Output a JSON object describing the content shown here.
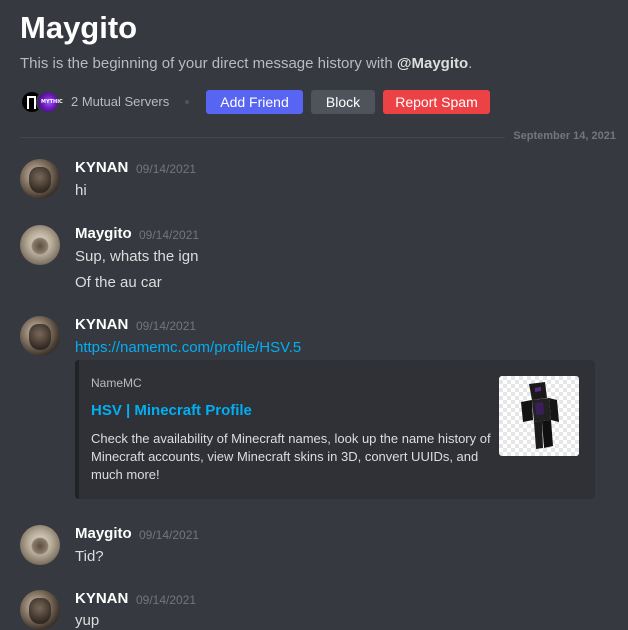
{
  "header": {
    "title": "Maygito",
    "subtitle_prefix": "This is the beginning of your direct message history with ",
    "subtitle_handle": "@Maygito",
    "subtitle_suffix": "."
  },
  "actions": {
    "mutual_servers": "2 Mutual Servers",
    "server_icon_2_text": "MYTHIC",
    "add_friend": "Add Friend",
    "block": "Block",
    "report_spam": "Report Spam"
  },
  "divider_date": "September 14, 2021",
  "messages": [
    {
      "author": "KYNAN",
      "timestamp": "09/14/2021",
      "lines": [
        "hi"
      ]
    },
    {
      "author": "Maygito",
      "timestamp": "09/14/2021",
      "lines": [
        "Sup, whats the ign",
        "Of the au car"
      ]
    },
    {
      "author": "KYNAN",
      "timestamp": "09/14/2021",
      "link": "https://namemc.com/profile/HSV.5"
    },
    {
      "author": "Maygito",
      "timestamp": "09/14/2021",
      "lines": [
        "Tid?"
      ]
    },
    {
      "author": "KYNAN",
      "timestamp": "09/14/2021",
      "lines": [
        "yup"
      ]
    }
  ],
  "embed": {
    "provider": "NameMC",
    "title": "HSV | Minecraft Profile",
    "description": "Check the availability of Minecraft names, look up the name history of Minecraft accounts, view Minecraft skins in 3D, convert UUIDs, and much more!"
  },
  "colors": {
    "background": "#36393f",
    "blurple": "#5865f2",
    "danger": "#ed4245",
    "secondary": "#4f545c",
    "link": "#00aff4"
  }
}
